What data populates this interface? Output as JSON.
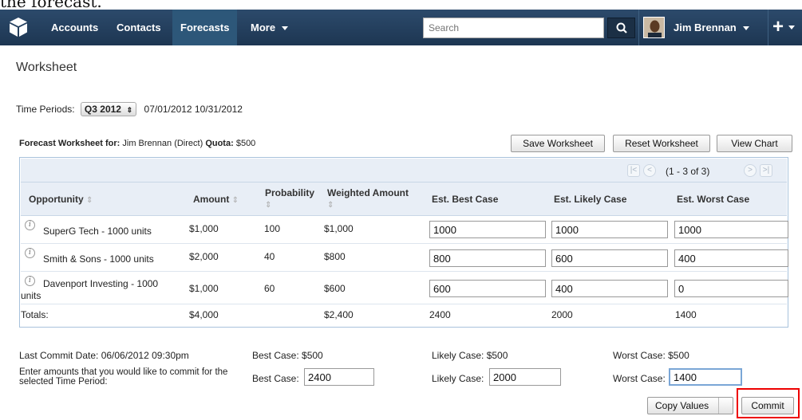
{
  "bleed_text": "the forecast.",
  "nav": {
    "tabs": [
      "Accounts",
      "Contacts",
      "Forecasts",
      "More"
    ],
    "search_placeholder": "Search",
    "user": "Jim Brennan",
    "plus": "+"
  },
  "page": {
    "title": "Worksheet",
    "time_period_label": "Time Periods:",
    "time_period_value": "Q3 2012",
    "time_period_dates": "07/01/2012 10/31/2012",
    "worksheet_for_label": "Forecast Worksheet for:",
    "worksheet_for_value": "Jim Brennan (Direct)",
    "quota_label": "Quota:",
    "quota_value": "$500"
  },
  "toolbar": {
    "save": "Save Worksheet",
    "reset": "Reset Worksheet",
    "view_chart": "View Chart"
  },
  "pager": {
    "text": "(1 - 3 of 3)"
  },
  "table": {
    "headers": {
      "opportunity": "Opportunity",
      "amount": "Amount",
      "probability": "Probability",
      "weighted": "Weighted Amount",
      "best": "Est. Best Case",
      "likely": "Est. Likely Case",
      "worst": "Est. Worst Case"
    },
    "rows": [
      {
        "name": "SuperG Tech - 1000 units",
        "amount": "$1,000",
        "probability": "100",
        "weighted": "$1,000",
        "best": "1000",
        "likely": "1000",
        "worst": "1000"
      },
      {
        "name": "Smith & Sons - 1000 units",
        "amount": "$2,000",
        "probability": "40",
        "weighted": "$800",
        "best": "800",
        "likely": "600",
        "worst": "400"
      },
      {
        "name_line1": "Davenport Investing - 1000",
        "name_line2": "units",
        "amount": "$1,000",
        "probability": "60",
        "weighted": "$600",
        "best": "600",
        "likely": "400",
        "worst": "0"
      }
    ],
    "totals": {
      "label": "Totals:",
      "amount": "$4,000",
      "weighted": "$2,400",
      "best": "2400",
      "likely": "2000",
      "worst": "1400"
    }
  },
  "commit": {
    "last_commit": "Last Commit Date: 06/06/2012 09:30pm",
    "best_prev": "Best Case: $500",
    "likely_prev": "Likely Case: $500",
    "worst_prev": "Worst Case: $500",
    "instructions": "Enter amounts that you would like to commit for the selected Time Period:",
    "best_label": "Best Case:",
    "best_value": "2400",
    "likely_label": "Likely Case:",
    "likely_value": "2000",
    "worst_label": "Worst Case:",
    "worst_value": "1400",
    "copy_values": "Copy Values",
    "commit_button": "Commit"
  },
  "colors": {
    "nav": "#1d3652",
    "active_tab": "#2d5779",
    "highlight": "#ee0000"
  },
  "icons": {
    "logo": "cube-icon",
    "search": "search-icon",
    "info": "info-icon",
    "sort": "sort-icon"
  }
}
